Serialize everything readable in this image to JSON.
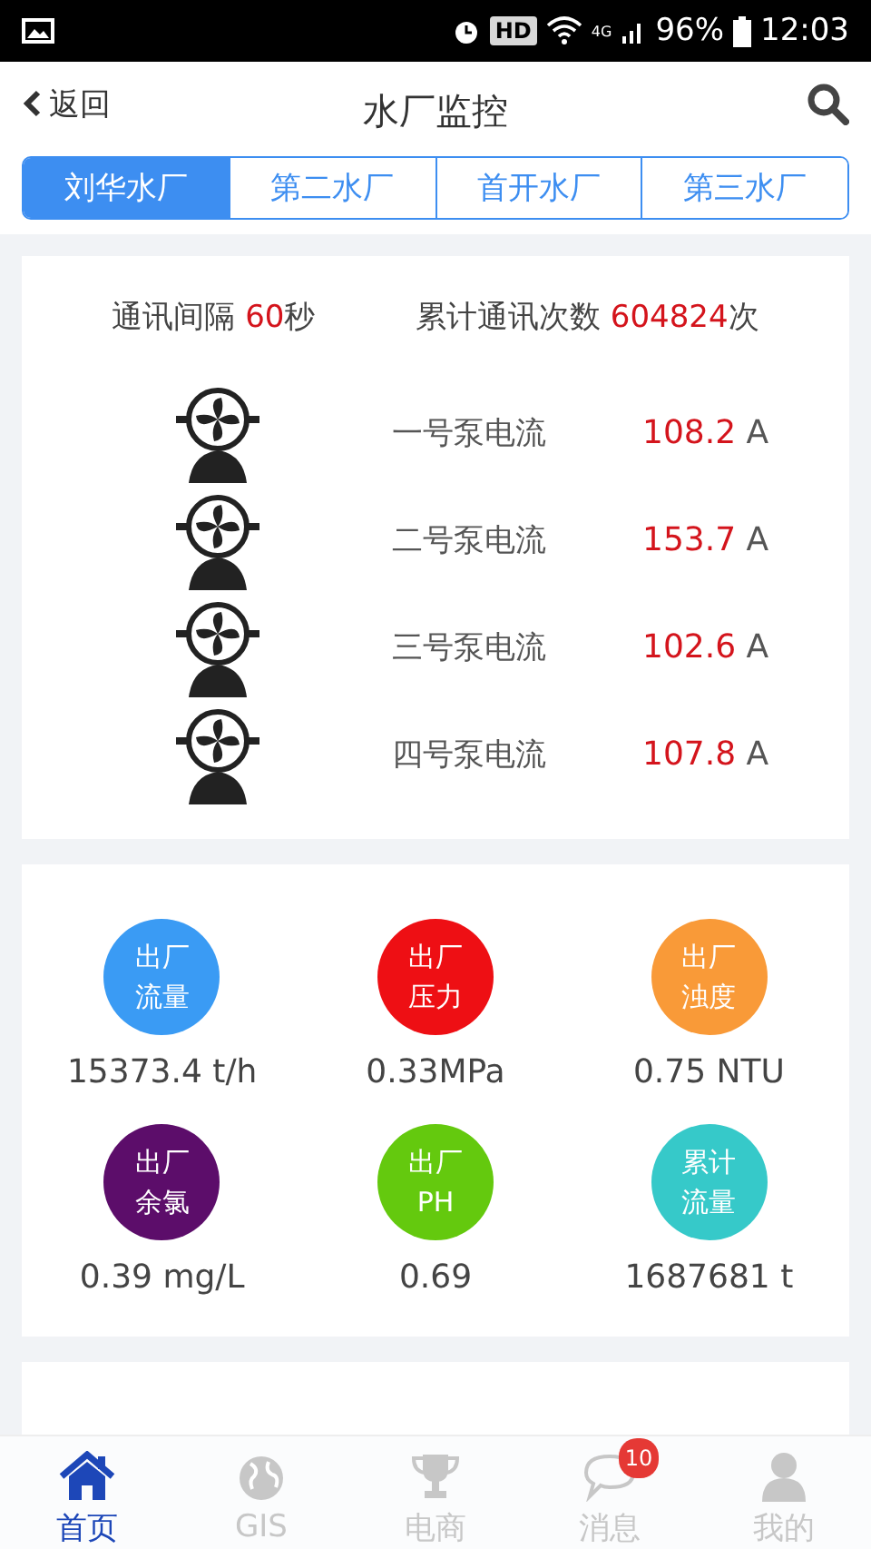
{
  "status_bar": {
    "hd": "HD",
    "network": "4G",
    "battery": "96%",
    "time": "12:03"
  },
  "header": {
    "back": "返回",
    "title": "水厂监控"
  },
  "tabs": [
    {
      "label": "刘华水厂",
      "selected": true
    },
    {
      "label": "第二水厂",
      "selected": false
    },
    {
      "label": "首开水厂",
      "selected": false
    },
    {
      "label": "第三水厂",
      "selected": false
    }
  ],
  "comm": [
    {
      "label": "通讯间隔",
      "value": "60",
      "unit": "秒"
    },
    {
      "label": "累计通讯次数",
      "value": "604824",
      "unit": "次"
    }
  ],
  "pumps": [
    {
      "name": "一号泵电流",
      "value": "108.2",
      "unit": "A"
    },
    {
      "name": "二号泵电流",
      "value": "153.7",
      "unit": "A"
    },
    {
      "name": "三号泵电流",
      "value": "102.6",
      "unit": "A"
    },
    {
      "name": "四号泵电流",
      "value": "107.8",
      "unit": "A"
    }
  ],
  "metrics": [
    {
      "line1": "出厂",
      "line2": "流量",
      "color": "#3a9bf4",
      "value": "15373.4 t/h"
    },
    {
      "line1": "出厂",
      "line2": "压力",
      "color": "#ee0f14",
      "value": "0.33MPa"
    },
    {
      "line1": "出厂",
      "line2": "浊度",
      "color": "#f99a38",
      "value": "0.75 NTU"
    },
    {
      "line1": "出厂",
      "line2": "余氯",
      "color": "#5c0d6a",
      "value": "0.39 mg/L"
    },
    {
      "line1": "出厂",
      "line2": "PH",
      "color": "#64c90e",
      "value": "0.69"
    },
    {
      "line1": "累计",
      "line2": "流量",
      "color": "#36c9c9",
      "value": "1687681 t"
    }
  ],
  "nav": [
    {
      "kind": "home",
      "label": "首页",
      "selected": true
    },
    {
      "kind": "globe",
      "label": "GIS",
      "selected": false
    },
    {
      "kind": "trophy",
      "label": "电商",
      "selected": false
    },
    {
      "kind": "chat",
      "label": "消息",
      "selected": false,
      "badge": "10"
    },
    {
      "kind": "person",
      "label": "我的",
      "selected": false
    }
  ]
}
